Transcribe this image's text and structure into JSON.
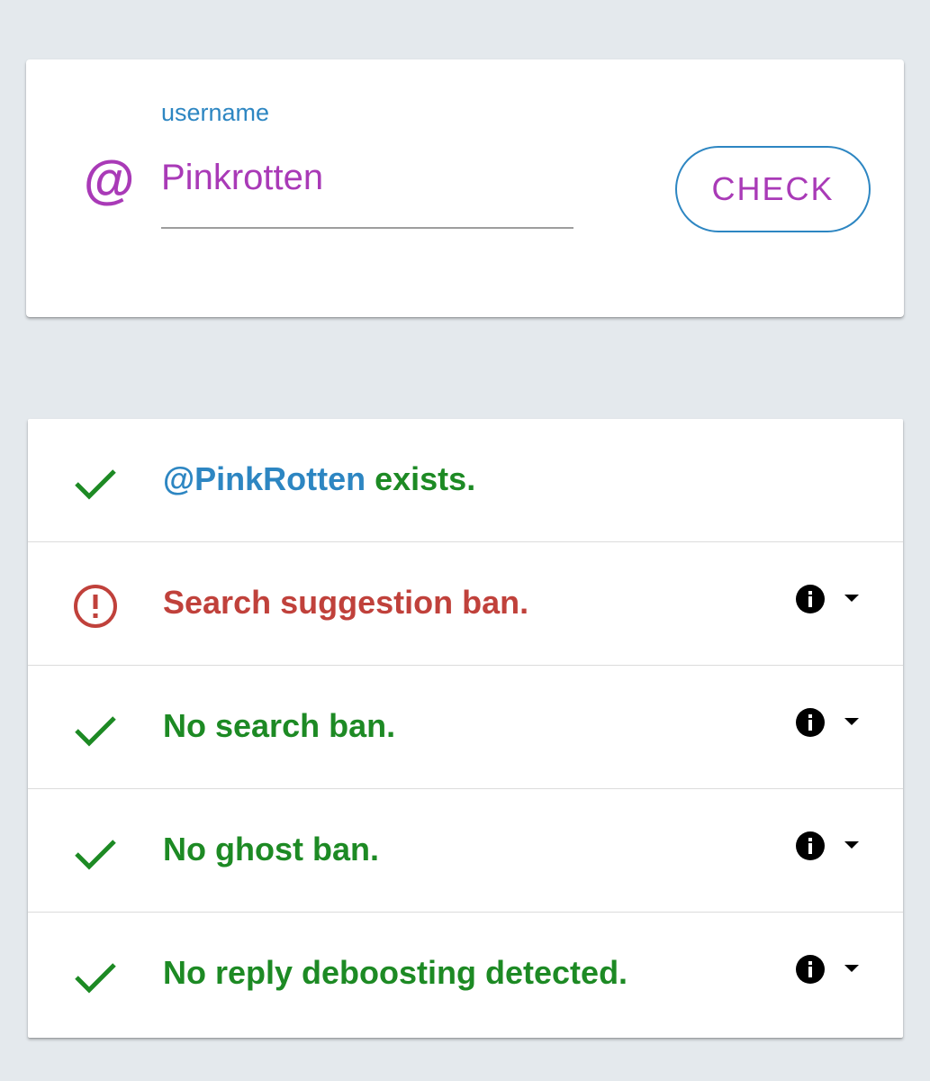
{
  "search": {
    "at_symbol": "@",
    "label": "username",
    "value": "Pinkrotten",
    "button_label": "CHECK",
    "icon": "at-icon"
  },
  "results": [
    {
      "status": "ok",
      "status_icon": "checkmark-icon",
      "handle": "@PinkRotten",
      "text": " exists.",
      "has_details": false
    },
    {
      "status": "error",
      "status_icon": "alert-circle-icon",
      "text": "Search suggestion ban.",
      "has_details": true
    },
    {
      "status": "ok",
      "status_icon": "checkmark-icon",
      "text": "No search ban.",
      "has_details": true
    },
    {
      "status": "ok",
      "status_icon": "checkmark-icon",
      "text": "No ghost ban.",
      "has_details": true
    },
    {
      "status": "ok",
      "status_icon": "checkmark-icon",
      "text": "No reply deboosting detected.",
      "has_details": true
    }
  ],
  "colors": {
    "accent": "#a93ab7",
    "primary": "#2d86c2",
    "success": "#1d8a24",
    "error": "#c0413b",
    "background": "#e4e9ed"
  }
}
